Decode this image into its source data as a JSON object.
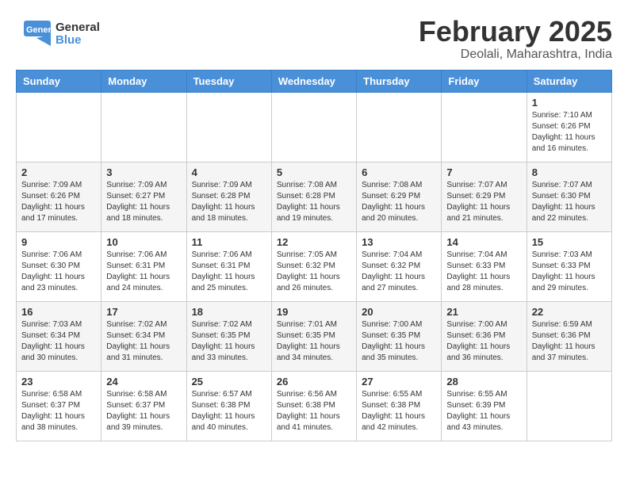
{
  "header": {
    "logo_general": "General",
    "logo_blue": "Blue",
    "title": "February 2025",
    "subtitle": "Deolali, Maharashtra, India"
  },
  "calendar": {
    "columns": [
      "Sunday",
      "Monday",
      "Tuesday",
      "Wednesday",
      "Thursday",
      "Friday",
      "Saturday"
    ],
    "weeks": [
      {
        "alt": false,
        "days": [
          {
            "num": "",
            "info": ""
          },
          {
            "num": "",
            "info": ""
          },
          {
            "num": "",
            "info": ""
          },
          {
            "num": "",
            "info": ""
          },
          {
            "num": "",
            "info": ""
          },
          {
            "num": "",
            "info": ""
          },
          {
            "num": "1",
            "info": "Sunrise: 7:10 AM\nSunset: 6:26 PM\nDaylight: 11 hours and 16 minutes."
          }
        ]
      },
      {
        "alt": true,
        "days": [
          {
            "num": "2",
            "info": "Sunrise: 7:09 AM\nSunset: 6:26 PM\nDaylight: 11 hours and 17 minutes."
          },
          {
            "num": "3",
            "info": "Sunrise: 7:09 AM\nSunset: 6:27 PM\nDaylight: 11 hours and 18 minutes."
          },
          {
            "num": "4",
            "info": "Sunrise: 7:09 AM\nSunset: 6:28 PM\nDaylight: 11 hours and 18 minutes."
          },
          {
            "num": "5",
            "info": "Sunrise: 7:08 AM\nSunset: 6:28 PM\nDaylight: 11 hours and 19 minutes."
          },
          {
            "num": "6",
            "info": "Sunrise: 7:08 AM\nSunset: 6:29 PM\nDaylight: 11 hours and 20 minutes."
          },
          {
            "num": "7",
            "info": "Sunrise: 7:07 AM\nSunset: 6:29 PM\nDaylight: 11 hours and 21 minutes."
          },
          {
            "num": "8",
            "info": "Sunrise: 7:07 AM\nSunset: 6:30 PM\nDaylight: 11 hours and 22 minutes."
          }
        ]
      },
      {
        "alt": false,
        "days": [
          {
            "num": "9",
            "info": "Sunrise: 7:06 AM\nSunset: 6:30 PM\nDaylight: 11 hours and 23 minutes."
          },
          {
            "num": "10",
            "info": "Sunrise: 7:06 AM\nSunset: 6:31 PM\nDaylight: 11 hours and 24 minutes."
          },
          {
            "num": "11",
            "info": "Sunrise: 7:06 AM\nSunset: 6:31 PM\nDaylight: 11 hours and 25 minutes."
          },
          {
            "num": "12",
            "info": "Sunrise: 7:05 AM\nSunset: 6:32 PM\nDaylight: 11 hours and 26 minutes."
          },
          {
            "num": "13",
            "info": "Sunrise: 7:04 AM\nSunset: 6:32 PM\nDaylight: 11 hours and 27 minutes."
          },
          {
            "num": "14",
            "info": "Sunrise: 7:04 AM\nSunset: 6:33 PM\nDaylight: 11 hours and 28 minutes."
          },
          {
            "num": "15",
            "info": "Sunrise: 7:03 AM\nSunset: 6:33 PM\nDaylight: 11 hours and 29 minutes."
          }
        ]
      },
      {
        "alt": true,
        "days": [
          {
            "num": "16",
            "info": "Sunrise: 7:03 AM\nSunset: 6:34 PM\nDaylight: 11 hours and 30 minutes."
          },
          {
            "num": "17",
            "info": "Sunrise: 7:02 AM\nSunset: 6:34 PM\nDaylight: 11 hours and 31 minutes."
          },
          {
            "num": "18",
            "info": "Sunrise: 7:02 AM\nSunset: 6:35 PM\nDaylight: 11 hours and 33 minutes."
          },
          {
            "num": "19",
            "info": "Sunrise: 7:01 AM\nSunset: 6:35 PM\nDaylight: 11 hours and 34 minutes."
          },
          {
            "num": "20",
            "info": "Sunrise: 7:00 AM\nSunset: 6:35 PM\nDaylight: 11 hours and 35 minutes."
          },
          {
            "num": "21",
            "info": "Sunrise: 7:00 AM\nSunset: 6:36 PM\nDaylight: 11 hours and 36 minutes."
          },
          {
            "num": "22",
            "info": "Sunrise: 6:59 AM\nSunset: 6:36 PM\nDaylight: 11 hours and 37 minutes."
          }
        ]
      },
      {
        "alt": false,
        "days": [
          {
            "num": "23",
            "info": "Sunrise: 6:58 AM\nSunset: 6:37 PM\nDaylight: 11 hours and 38 minutes."
          },
          {
            "num": "24",
            "info": "Sunrise: 6:58 AM\nSunset: 6:37 PM\nDaylight: 11 hours and 39 minutes."
          },
          {
            "num": "25",
            "info": "Sunrise: 6:57 AM\nSunset: 6:38 PM\nDaylight: 11 hours and 40 minutes."
          },
          {
            "num": "26",
            "info": "Sunrise: 6:56 AM\nSunset: 6:38 PM\nDaylight: 11 hours and 41 minutes."
          },
          {
            "num": "27",
            "info": "Sunrise: 6:55 AM\nSunset: 6:38 PM\nDaylight: 11 hours and 42 minutes."
          },
          {
            "num": "28",
            "info": "Sunrise: 6:55 AM\nSunset: 6:39 PM\nDaylight: 11 hours and 43 minutes."
          },
          {
            "num": "",
            "info": ""
          }
        ]
      }
    ]
  }
}
